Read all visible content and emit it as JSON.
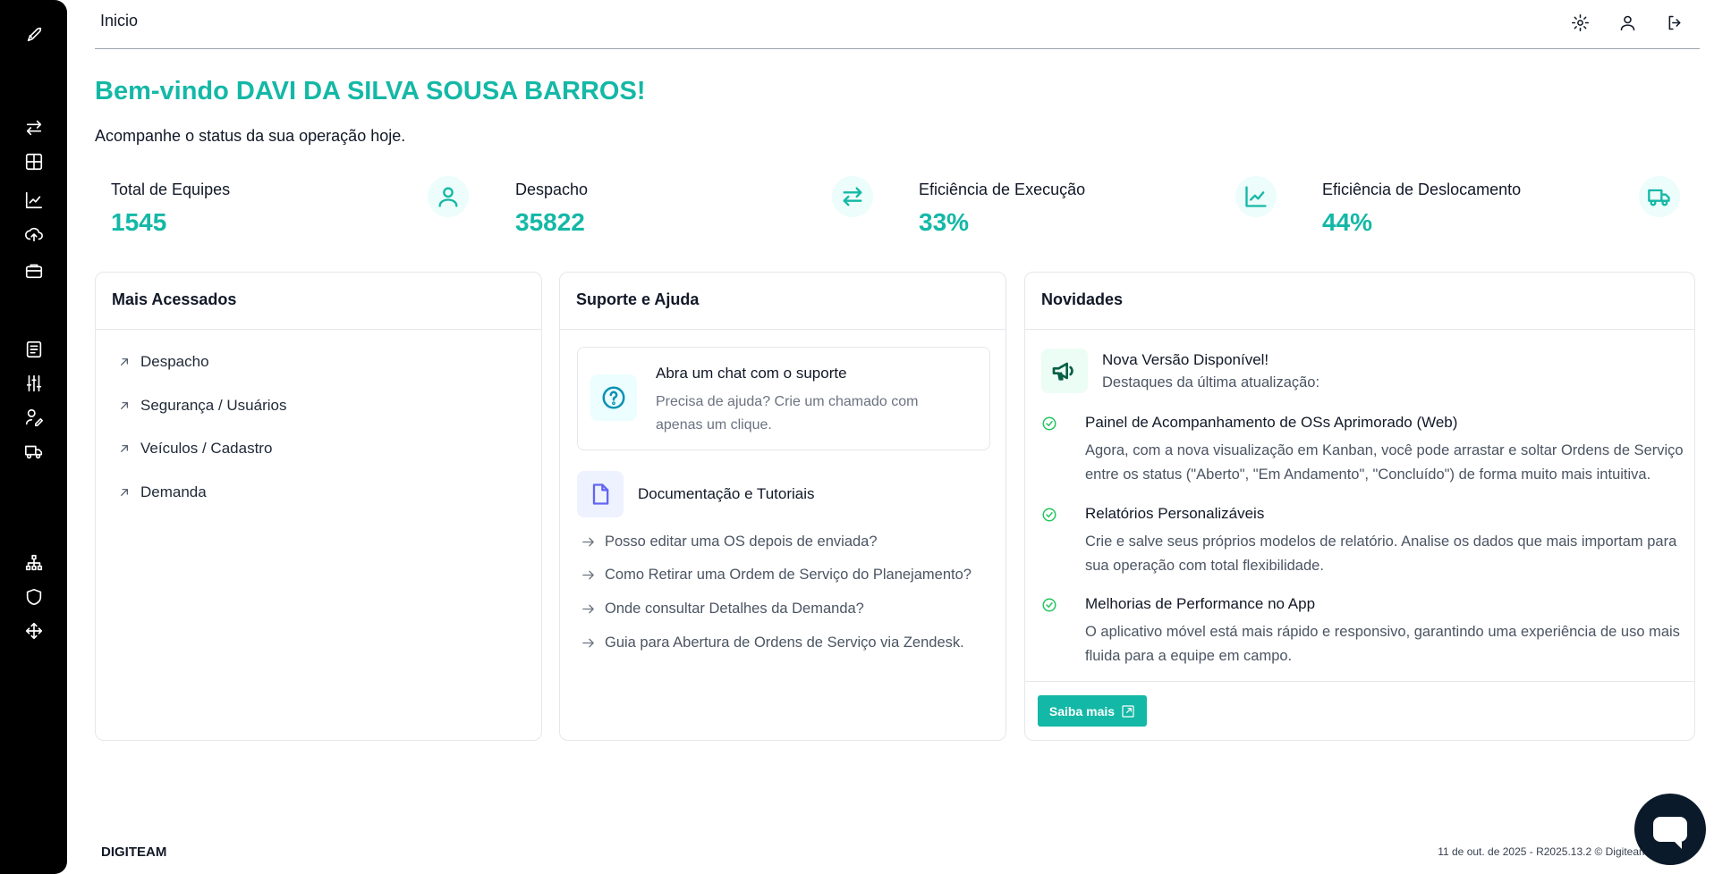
{
  "header": {
    "title": "Inicio"
  },
  "sidebar": {
    "icons": [
      "rocket-icon",
      "transfer-icon",
      "grid-icon",
      "chart-line-icon",
      "cloud-upload-icon",
      "briefcase-icon",
      "document-list-icon",
      "sliders-icon",
      "user-edit-icon",
      "truck-icon",
      "hierarchy-icon",
      "shield-icon",
      "move-icon"
    ]
  },
  "topbar_icons": [
    "settings-icon",
    "user-icon",
    "logout-icon"
  ],
  "welcome": {
    "title": "Bem-vindo DAVI DA SILVA SOUSA BARROS!",
    "subtitle": "Acompanhe o status da sua operação hoje."
  },
  "stats": [
    {
      "label": "Total de Equipes",
      "value": "1545",
      "icon": "user-icon"
    },
    {
      "label": "Despacho",
      "value": "35822",
      "icon": "transfer-icon"
    },
    {
      "label": "Eficiência de Execução",
      "value": "33%",
      "icon": "chart-line-icon"
    },
    {
      "label": "Eficiência de Deslocamento",
      "value": "44%",
      "icon": "truck-icon"
    }
  ],
  "most_accessed": {
    "title": "Mais Acessados",
    "links": [
      "Despacho",
      "Segurança / Usuários",
      "Veículos / Cadastro",
      "Demanda"
    ]
  },
  "support": {
    "title": "Suporte e Ajuda",
    "chat": {
      "title": "Abra um chat com o suporte",
      "description": "Precisa de ajuda? Crie um chamado com apenas um clique."
    },
    "docs": {
      "title": "Documentação e Tutoriais",
      "links": [
        "Posso editar uma OS depois de enviada?",
        "Como Retirar uma Ordem de Serviço do Planejamento?",
        "Onde consultar Detalhes da Demanda?",
        "Guia para Abertura de Ordens de Serviço via Zendesk."
      ]
    }
  },
  "news": {
    "title": "Novidades",
    "headline": "Nova Versão Disponível!",
    "subheadline": "Destaques da última atualização:",
    "items": [
      {
        "title": "Painel de Acompanhamento de OSs Aprimorado (Web)",
        "description": "Agora, com a nova visualização em Kanban, você pode arrastar e soltar Ordens de Serviço entre os status (\"Aberto\", \"Em Andamento\", \"Concluído\") de forma muito mais intuitiva."
      },
      {
        "title": "Relatórios Personalizáveis",
        "description": "Crie e salve seus próprios modelos de relatório. Analise os dados que mais importam para sua operação com total flexibilidade."
      },
      {
        "title": "Melhorias de Performance no App",
        "description": "O aplicativo móvel está mais rápido e responsivo, garantindo uma experiência de uso mais fluida para a equipe em campo."
      }
    ],
    "button": "Saiba mais"
  },
  "footer": {
    "brand": "DIGITEAM",
    "version": "11 de out. de 2025 - R2025.13.2 © Digiteam"
  },
  "colors": {
    "accent": "#14b8a6",
    "sidebar": "#000000"
  }
}
